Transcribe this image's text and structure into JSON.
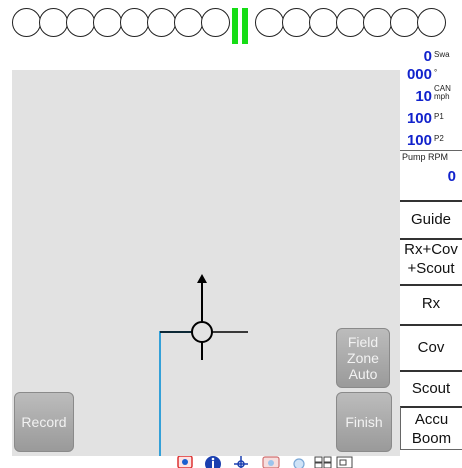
{
  "colors": {
    "section_active": "#16dd16",
    "stat_blue": "#1122cc",
    "map_background": "#e2e2e2",
    "map_button": "#a9a9a9",
    "path_line": "#33a0d8"
  },
  "section_bar": {
    "left_sections": 8,
    "right_sections": 7,
    "icon": "boom-section-icon"
  },
  "stats": {
    "swath": {
      "value": "0",
      "unit": "Swa"
    },
    "heading": {
      "value": "000",
      "unit": "°"
    },
    "speed": {
      "value": "10",
      "unit_top": "CAN",
      "unit_bottom": "mph"
    },
    "p1": {
      "value": "100",
      "unit": "P1"
    },
    "p2": {
      "value": "100",
      "unit": "P2"
    }
  },
  "pump": {
    "label": "Pump RPM",
    "value": "0"
  },
  "side_buttons": {
    "guide": "Guide",
    "rx_cov_line1": "Rx+Cov",
    "rx_cov_line2": "+Scout",
    "rx": "Rx",
    "cov": "Cov",
    "scout": "Scout",
    "accu_line1": "Accu",
    "accu_line2": "Boom"
  },
  "map_buttons": {
    "field_line1": "Field",
    "field_line2": "Zone",
    "field_line3": "Auto",
    "record": "Record",
    "finish": "Finish"
  },
  "bottom_icons": [
    "gps-icon",
    "info-icon",
    "vehicle-icon",
    "screen-icon",
    "zoom-icon",
    "layout-icon",
    "more-icon"
  ]
}
